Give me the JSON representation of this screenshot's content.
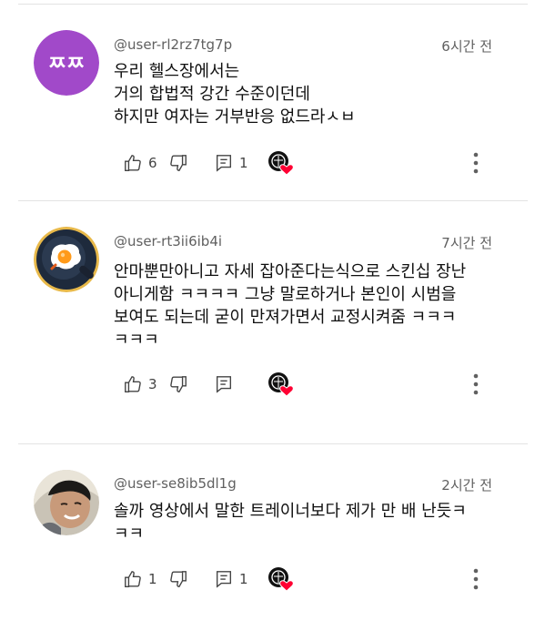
{
  "comments": [
    {
      "username": "@user-rl2rz7tg7p",
      "time": "6시간 전",
      "avatar": {
        "type": "text",
        "text": "ㅉㅉ",
        "color": "#a149c9"
      },
      "lines": [
        "우리 헬스장에서는",
        "거의 합법적 강간 수준이던데",
        "하지만 여자는 거부반응 없드라ㅅㅂ"
      ],
      "likes": "6",
      "replies": "1"
    },
    {
      "username": "@user-rt3ii6ib4i",
      "time": "7시간 전",
      "avatar": {
        "type": "egg-pan"
      },
      "lines": [
        "안마뿐만아니고 자세 잡아준다는식으로 스킨십 장난",
        "아니게함 ㅋㅋㅋㅋ 그냥 말로하거나 본인이 시범을",
        "보여도 되는데 굳이 만져가면서 교정시켜줌 ㅋㅋㅋ",
        "ㅋㅋㅋ"
      ],
      "likes": "3",
      "replies": ""
    },
    {
      "username": "@user-se8ib5dl1g",
      "time": "2시간 전",
      "avatar": {
        "type": "photo"
      },
      "lines": [
        "솔까 영상에서 말한 트레이너보다 제가 만 배 난듯ㅋ",
        "ㅋㅋ"
      ],
      "likes": "1",
      "replies": "1"
    }
  ],
  "colors": {
    "accent_heart": "#ff0033",
    "text_secondary": "#606060"
  }
}
